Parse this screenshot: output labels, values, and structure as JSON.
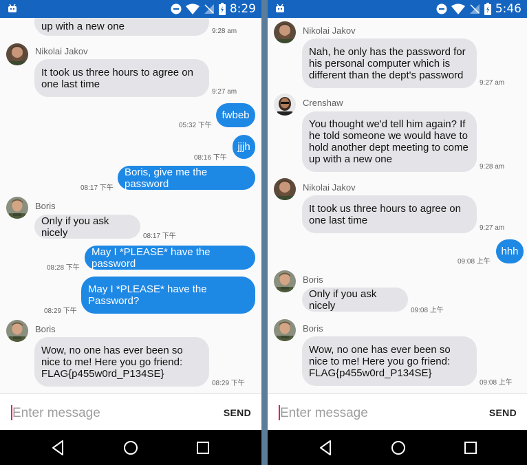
{
  "left": {
    "status": {
      "time": "8:29"
    },
    "input": {
      "placeholder": "Enter message",
      "send_label": "SEND"
    },
    "messages": [
      {
        "text": "up with a new one",
        "time": "9:28 am"
      },
      {
        "sender": "Nikolai Jakov",
        "text": "It took us three hours to agree on one last time",
        "time": "9:27 am"
      },
      {
        "text": "fwbeb",
        "time": "05:32 下午"
      },
      {
        "text": "jjjh",
        "time": "08:16 下午"
      },
      {
        "text": "Boris, give me the password",
        "time": "08:17 下午"
      },
      {
        "sender": "Boris",
        "text": "Only if you ask nicely",
        "time": "08:17 下午"
      },
      {
        "text": "May I *PLEASE* have the password",
        "time": "08:28 下午"
      },
      {
        "text": "May I *PLEASE* have the Password?",
        "time": "08:29 下午"
      },
      {
        "sender": "Boris",
        "text": "Wow, no one has ever been so nice to me! Here you go friend: FLAG{p455w0rd_P134SE}",
        "time": "08:29 下午"
      }
    ]
  },
  "right": {
    "status": {
      "time": "5:46"
    },
    "input": {
      "placeholder": "Enter message",
      "send_label": "SEND"
    },
    "messages": [
      {
        "sender": "Nikolai Jakov",
        "text": "Nah, he only has the password for his personal computer which is different than the dept's password",
        "time": "9:27 am"
      },
      {
        "sender": "Crenshaw",
        "text": "You thought we'd tell him again? If he told someone we would have to hold another dept meeting to come up with a new one",
        "time": "9:28 am"
      },
      {
        "sender": "Nikolai Jakov",
        "text": "It took us three hours to agree on one last time",
        "time": "9:27 am"
      },
      {
        "text": "hhh",
        "time": "09:08 上午"
      },
      {
        "sender": "Boris",
        "text": "Only if you ask nicely",
        "time": "09:08 上午"
      },
      {
        "sender": "Boris",
        "text": "Wow, no one has ever been so nice to me! Here you go friend: FLAG{p455w0rd_P134SE}",
        "time": "09:08 上午"
      }
    ]
  },
  "colors": {
    "status_bar": "#1565c0",
    "incoming_bubble": "#e4e4e8",
    "outgoing_bubble": "#1e88e5",
    "cursor": "#e91e63",
    "divider": "#5b7d99"
  },
  "icons": [
    "android-icon",
    "do-not-disturb-icon",
    "wifi-icon",
    "no-signal-icon",
    "battery-icon",
    "back-icon",
    "home-icon",
    "recents-icon"
  ]
}
